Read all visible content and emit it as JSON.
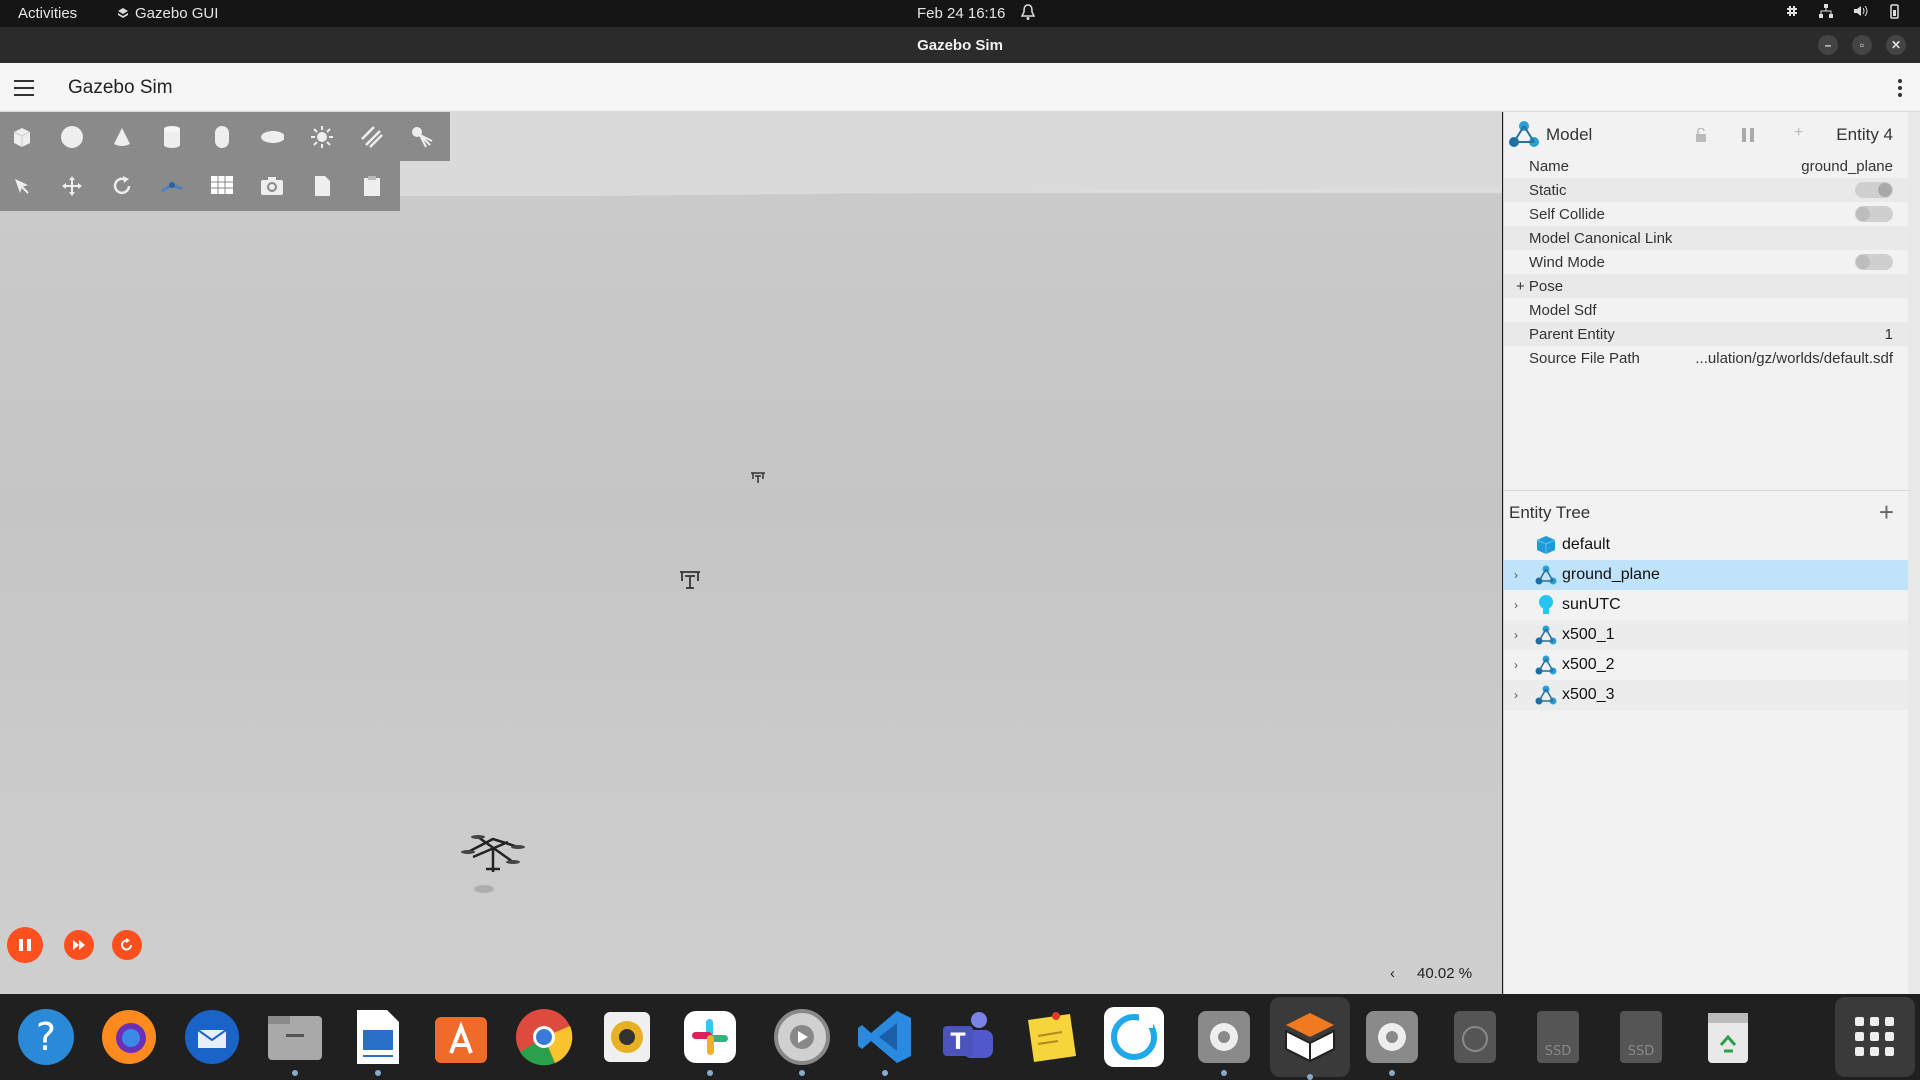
{
  "topbar": {
    "activities": "Activities",
    "app_name": "Gazebo GUI",
    "datetime": "Feb 24  16:16"
  },
  "window": {
    "title": "Gazebo Sim",
    "app_title": "Gazebo Sim"
  },
  "component_inspector": {
    "type": "Model",
    "entity": "Entity 4",
    "properties": [
      {
        "label": "Name",
        "value": "ground_plane"
      },
      {
        "label": "Static",
        "toggle": true,
        "on": true
      },
      {
        "label": "Self Collide",
        "toggle": true,
        "on": false
      },
      {
        "label": "Model Canonical Link",
        "value": ""
      },
      {
        "label": "Wind Mode",
        "toggle": true,
        "on": false
      },
      {
        "label": "+ Pose",
        "value": ""
      },
      {
        "label": "Model Sdf",
        "value": ""
      },
      {
        "label": "Parent Entity",
        "value": "1"
      },
      {
        "label": "Source File Path",
        "value": "...ulation/gz/worlds/default.sdf"
      }
    ]
  },
  "entity_tree": {
    "title": "Entity Tree",
    "items": [
      {
        "label": "default",
        "icon": "world-icon",
        "expandable": false,
        "selected": false
      },
      {
        "label": "ground_plane",
        "icon": "model-icon",
        "expandable": true,
        "selected": true
      },
      {
        "label": "sunUTC",
        "icon": "light-icon",
        "expandable": true,
        "selected": false
      },
      {
        "label": "x500_1",
        "icon": "model-icon",
        "expandable": true,
        "selected": false
      },
      {
        "label": "x500_2",
        "icon": "model-icon",
        "expandable": true,
        "selected": false
      },
      {
        "label": "x500_3",
        "icon": "model-icon",
        "expandable": true,
        "selected": false
      }
    ]
  },
  "scene": {
    "zoom_arrow": "‹",
    "zoom_value": "40.02 %"
  },
  "colors": {
    "accent": "#ff4f1f",
    "selection": "#bfe3fb",
    "toolbar": "#8a8a8a"
  }
}
